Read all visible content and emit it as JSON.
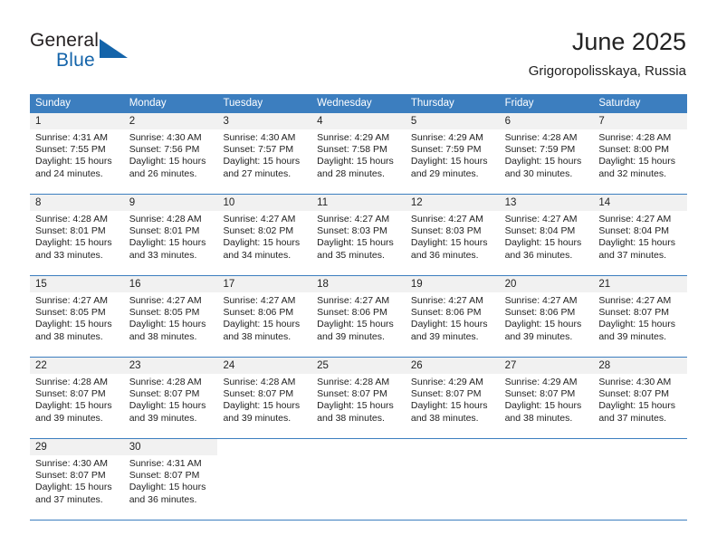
{
  "logo": {
    "word_one": "General",
    "word_two": "Blue",
    "triangle_color": "#1464aa"
  },
  "header": {
    "title": "June 2025",
    "subtitle": "Grigoropolisskaya, Russia"
  },
  "theme": {
    "header_blue": "#3c7ebf",
    "daynum_band": "#f1f1f1",
    "text": "#222222"
  },
  "weekdays": [
    "Sunday",
    "Monday",
    "Tuesday",
    "Wednesday",
    "Thursday",
    "Friday",
    "Saturday"
  ],
  "weeks": [
    [
      {
        "day": "1",
        "sunrise": "Sunrise: 4:31 AM",
        "sunset": "Sunset: 7:55 PM",
        "daylight_1": "Daylight: 15 hours",
        "daylight_2": "and 24 minutes."
      },
      {
        "day": "2",
        "sunrise": "Sunrise: 4:30 AM",
        "sunset": "Sunset: 7:56 PM",
        "daylight_1": "Daylight: 15 hours",
        "daylight_2": "and 26 minutes."
      },
      {
        "day": "3",
        "sunrise": "Sunrise: 4:30 AM",
        "sunset": "Sunset: 7:57 PM",
        "daylight_1": "Daylight: 15 hours",
        "daylight_2": "and 27 minutes."
      },
      {
        "day": "4",
        "sunrise": "Sunrise: 4:29 AM",
        "sunset": "Sunset: 7:58 PM",
        "daylight_1": "Daylight: 15 hours",
        "daylight_2": "and 28 minutes."
      },
      {
        "day": "5",
        "sunrise": "Sunrise: 4:29 AM",
        "sunset": "Sunset: 7:59 PM",
        "daylight_1": "Daylight: 15 hours",
        "daylight_2": "and 29 minutes."
      },
      {
        "day": "6",
        "sunrise": "Sunrise: 4:28 AM",
        "sunset": "Sunset: 7:59 PM",
        "daylight_1": "Daylight: 15 hours",
        "daylight_2": "and 30 minutes."
      },
      {
        "day": "7",
        "sunrise": "Sunrise: 4:28 AM",
        "sunset": "Sunset: 8:00 PM",
        "daylight_1": "Daylight: 15 hours",
        "daylight_2": "and 32 minutes."
      }
    ],
    [
      {
        "day": "8",
        "sunrise": "Sunrise: 4:28 AM",
        "sunset": "Sunset: 8:01 PM",
        "daylight_1": "Daylight: 15 hours",
        "daylight_2": "and 33 minutes."
      },
      {
        "day": "9",
        "sunrise": "Sunrise: 4:28 AM",
        "sunset": "Sunset: 8:01 PM",
        "daylight_1": "Daylight: 15 hours",
        "daylight_2": "and 33 minutes."
      },
      {
        "day": "10",
        "sunrise": "Sunrise: 4:27 AM",
        "sunset": "Sunset: 8:02 PM",
        "daylight_1": "Daylight: 15 hours",
        "daylight_2": "and 34 minutes."
      },
      {
        "day": "11",
        "sunrise": "Sunrise: 4:27 AM",
        "sunset": "Sunset: 8:03 PM",
        "daylight_1": "Daylight: 15 hours",
        "daylight_2": "and 35 minutes."
      },
      {
        "day": "12",
        "sunrise": "Sunrise: 4:27 AM",
        "sunset": "Sunset: 8:03 PM",
        "daylight_1": "Daylight: 15 hours",
        "daylight_2": "and 36 minutes."
      },
      {
        "day": "13",
        "sunrise": "Sunrise: 4:27 AM",
        "sunset": "Sunset: 8:04 PM",
        "daylight_1": "Daylight: 15 hours",
        "daylight_2": "and 36 minutes."
      },
      {
        "day": "14",
        "sunrise": "Sunrise: 4:27 AM",
        "sunset": "Sunset: 8:04 PM",
        "daylight_1": "Daylight: 15 hours",
        "daylight_2": "and 37 minutes."
      }
    ],
    [
      {
        "day": "15",
        "sunrise": "Sunrise: 4:27 AM",
        "sunset": "Sunset: 8:05 PM",
        "daylight_1": "Daylight: 15 hours",
        "daylight_2": "and 38 minutes."
      },
      {
        "day": "16",
        "sunrise": "Sunrise: 4:27 AM",
        "sunset": "Sunset: 8:05 PM",
        "daylight_1": "Daylight: 15 hours",
        "daylight_2": "and 38 minutes."
      },
      {
        "day": "17",
        "sunrise": "Sunrise: 4:27 AM",
        "sunset": "Sunset: 8:06 PM",
        "daylight_1": "Daylight: 15 hours",
        "daylight_2": "and 38 minutes."
      },
      {
        "day": "18",
        "sunrise": "Sunrise: 4:27 AM",
        "sunset": "Sunset: 8:06 PM",
        "daylight_1": "Daylight: 15 hours",
        "daylight_2": "and 39 minutes."
      },
      {
        "day": "19",
        "sunrise": "Sunrise: 4:27 AM",
        "sunset": "Sunset: 8:06 PM",
        "daylight_1": "Daylight: 15 hours",
        "daylight_2": "and 39 minutes."
      },
      {
        "day": "20",
        "sunrise": "Sunrise: 4:27 AM",
        "sunset": "Sunset: 8:06 PM",
        "daylight_1": "Daylight: 15 hours",
        "daylight_2": "and 39 minutes."
      },
      {
        "day": "21",
        "sunrise": "Sunrise: 4:27 AM",
        "sunset": "Sunset: 8:07 PM",
        "daylight_1": "Daylight: 15 hours",
        "daylight_2": "and 39 minutes."
      }
    ],
    [
      {
        "day": "22",
        "sunrise": "Sunrise: 4:28 AM",
        "sunset": "Sunset: 8:07 PM",
        "daylight_1": "Daylight: 15 hours",
        "daylight_2": "and 39 minutes."
      },
      {
        "day": "23",
        "sunrise": "Sunrise: 4:28 AM",
        "sunset": "Sunset: 8:07 PM",
        "daylight_1": "Daylight: 15 hours",
        "daylight_2": "and 39 minutes."
      },
      {
        "day": "24",
        "sunrise": "Sunrise: 4:28 AM",
        "sunset": "Sunset: 8:07 PM",
        "daylight_1": "Daylight: 15 hours",
        "daylight_2": "and 39 minutes."
      },
      {
        "day": "25",
        "sunrise": "Sunrise: 4:28 AM",
        "sunset": "Sunset: 8:07 PM",
        "daylight_1": "Daylight: 15 hours",
        "daylight_2": "and 38 minutes."
      },
      {
        "day": "26",
        "sunrise": "Sunrise: 4:29 AM",
        "sunset": "Sunset: 8:07 PM",
        "daylight_1": "Daylight: 15 hours",
        "daylight_2": "and 38 minutes."
      },
      {
        "day": "27",
        "sunrise": "Sunrise: 4:29 AM",
        "sunset": "Sunset: 8:07 PM",
        "daylight_1": "Daylight: 15 hours",
        "daylight_2": "and 38 minutes."
      },
      {
        "day": "28",
        "sunrise": "Sunrise: 4:30 AM",
        "sunset": "Sunset: 8:07 PM",
        "daylight_1": "Daylight: 15 hours",
        "daylight_2": "and 37 minutes."
      }
    ],
    [
      {
        "day": "29",
        "sunrise": "Sunrise: 4:30 AM",
        "sunset": "Sunset: 8:07 PM",
        "daylight_1": "Daylight: 15 hours",
        "daylight_2": "and 37 minutes."
      },
      {
        "day": "30",
        "sunrise": "Sunrise: 4:31 AM",
        "sunset": "Sunset: 8:07 PM",
        "daylight_1": "Daylight: 15 hours",
        "daylight_2": "and 36 minutes."
      },
      null,
      null,
      null,
      null,
      null
    ]
  ]
}
